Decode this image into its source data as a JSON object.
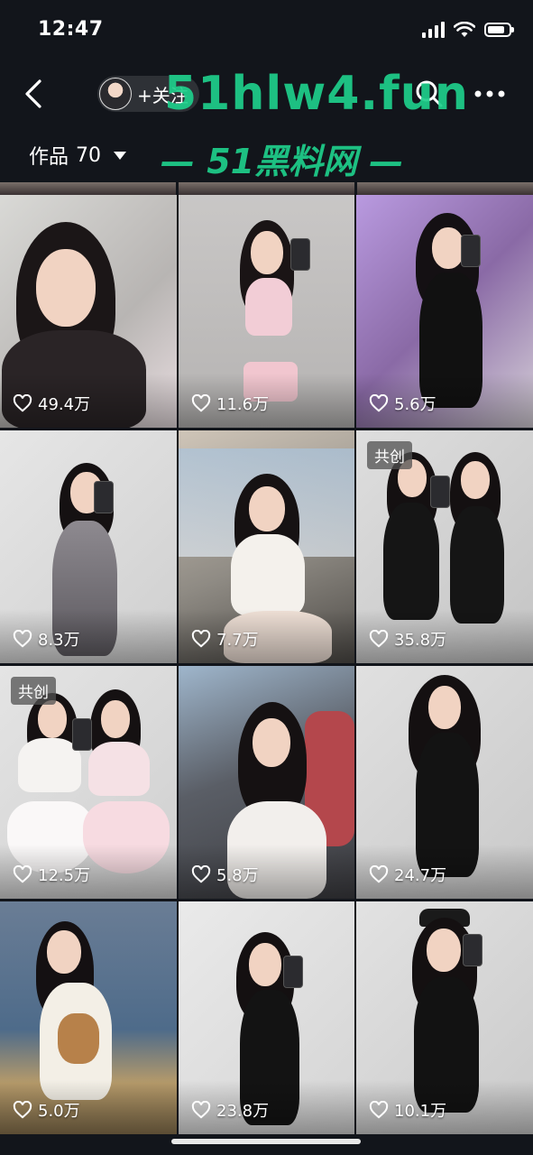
{
  "status_bar": {
    "time": "12:47"
  },
  "nav": {
    "follow_label": "+关注"
  },
  "watermark": {
    "domain": "51hlw4.fun",
    "subtitle": "— 51黑料网 —"
  },
  "works": {
    "label": "作品",
    "count": "70"
  },
  "colors": {
    "accent_watermark": "#1ecf8b",
    "background": "#12151b"
  },
  "tiles": [
    {
      "likes": "49.4万",
      "badge": ""
    },
    {
      "likes": "11.6万",
      "badge": ""
    },
    {
      "likes": "5.6万",
      "badge": ""
    },
    {
      "likes": "8.3万",
      "badge": ""
    },
    {
      "likes": "7.7万",
      "badge": ""
    },
    {
      "likes": "35.8万",
      "badge": "共创"
    },
    {
      "likes": "12.5万",
      "badge": "共创"
    },
    {
      "likes": "5.8万",
      "badge": ""
    },
    {
      "likes": "24.7万",
      "badge": ""
    },
    {
      "likes": "5.0万",
      "badge": ""
    },
    {
      "likes": "23.8万",
      "badge": ""
    },
    {
      "likes": "10.1万",
      "badge": ""
    }
  ]
}
